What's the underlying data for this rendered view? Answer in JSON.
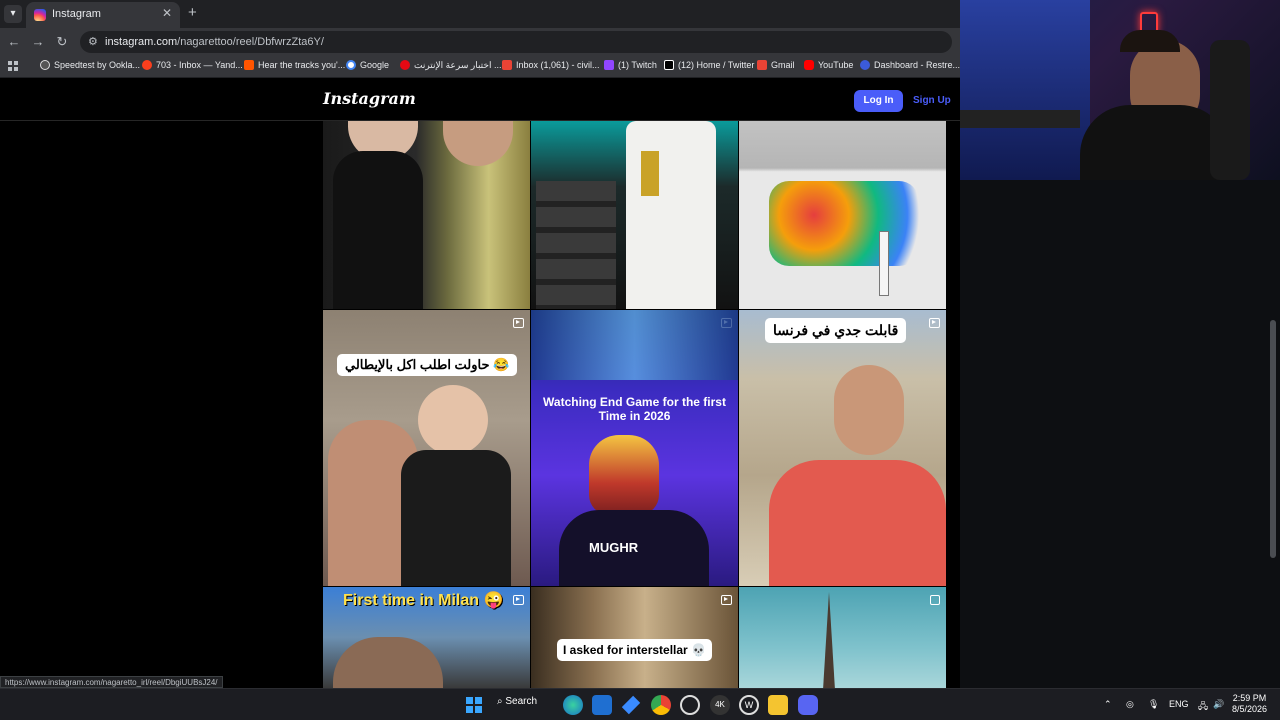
{
  "browser": {
    "tab": {
      "title": "Instagram"
    },
    "url": {
      "host": "instagram.com",
      "path": "/nagarettoo/reel/DbfwrzZta6Y/"
    },
    "bookmarks": [
      {
        "label": "Speedtest by Ookla...",
        "color": "#1c1c1c"
      },
      {
        "label": "703 - Inbox — Yand...",
        "color": "#fc3f1d"
      },
      {
        "label": "Hear the tracks you'...",
        "color": "#ff5500"
      },
      {
        "label": "Google",
        "color": "#4285f4"
      },
      {
        "label": "اختبار سرعة الإنترنت ...",
        "color": "#e50914"
      },
      {
        "label": "Inbox (1,061) - civil...",
        "color": "#ea4335"
      },
      {
        "label": "(1) Twitch",
        "color": "#9146ff"
      },
      {
        "label": "(12) Home / Twitter",
        "color": "#ffffff"
      },
      {
        "label": "Gmail",
        "color": "#ea4335"
      },
      {
        "label": "YouTube",
        "color": "#ff0000"
      },
      {
        "label": "Dashboard - Restre...",
        "color": "#3b5bdb"
      }
    ],
    "status_url": "https://www.instagram.com/nagaretto_irl/reel/DbgiUUBsJ24/"
  },
  "instagram": {
    "logo": "Instagram",
    "login_label": "Log In",
    "signup_label": "Sign Up",
    "captions": {
      "italian": "حاولت اطلب اكل بالإيطالي 😂",
      "endgame": "Watching End Game for the first Time in 2026",
      "france": "قابلت جدي في فرنسا",
      "milan": "First time in Milan 😜",
      "interstellar": "I asked for interstellar 💀"
    },
    "shirt_text": "MUGHR"
  },
  "taskbar": {
    "search_label": "Search",
    "lang": "ENG",
    "time": "2:59 PM",
    "date": "8/5/2026"
  },
  "colors": {
    "accent": "#4a5df9",
    "taskbar": "#1c1d22"
  }
}
